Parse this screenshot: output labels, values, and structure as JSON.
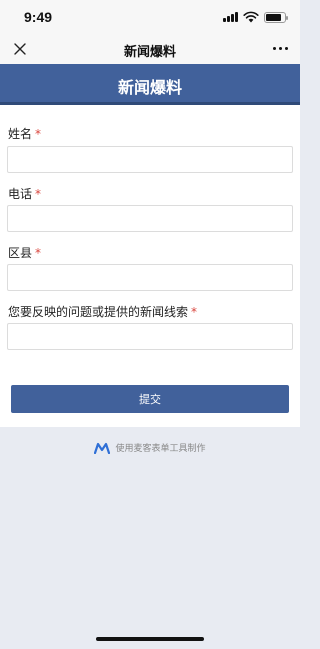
{
  "status_bar": {
    "time": "9:49"
  },
  "nav": {
    "title": "新闻爆料"
  },
  "banner": {
    "title": "新闻爆料"
  },
  "form": {
    "fields": [
      {
        "label": "姓名",
        "required_mark": "*",
        "value": ""
      },
      {
        "label": "电话",
        "required_mark": "*",
        "value": ""
      },
      {
        "label": "区县",
        "required_mark": "*",
        "value": ""
      },
      {
        "label": "您要反映的问题或提供的新闻线索",
        "required_mark": "*",
        "value": ""
      }
    ],
    "submit_label": "提交"
  },
  "footer": {
    "text": "使用麦客表单工具制作"
  },
  "icons": {
    "close": "close-icon",
    "more": "more-icon",
    "signal": "signal-icon",
    "wifi": "wifi-icon",
    "battery": "battery-icon",
    "logo": "maike-logo-icon"
  },
  "colors": {
    "primary": "#41619b",
    "required": "#d9453d",
    "page_background": "#e8ebf2"
  }
}
